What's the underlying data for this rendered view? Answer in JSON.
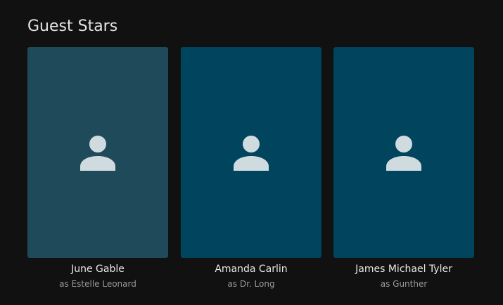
{
  "section": {
    "title": "Guest Stars"
  },
  "cast": [
    {
      "name": "June Gable",
      "role": "as Estelle Leonard",
      "icon": "person-placeholder-icon"
    },
    {
      "name": "Amanda Carlin",
      "role": "as Dr. Long",
      "icon": "person-placeholder-icon"
    },
    {
      "name": "James Michael Tyler",
      "role": "as Gunther",
      "icon": "person-placeholder-icon"
    }
  ],
  "colors": {
    "background": "#111111",
    "card": "#00455d",
    "card_hover": "#1f4a59",
    "icon": "#d0dbe0",
    "name_text": "#e8e8e8",
    "role_text": "#9a9a9a"
  }
}
